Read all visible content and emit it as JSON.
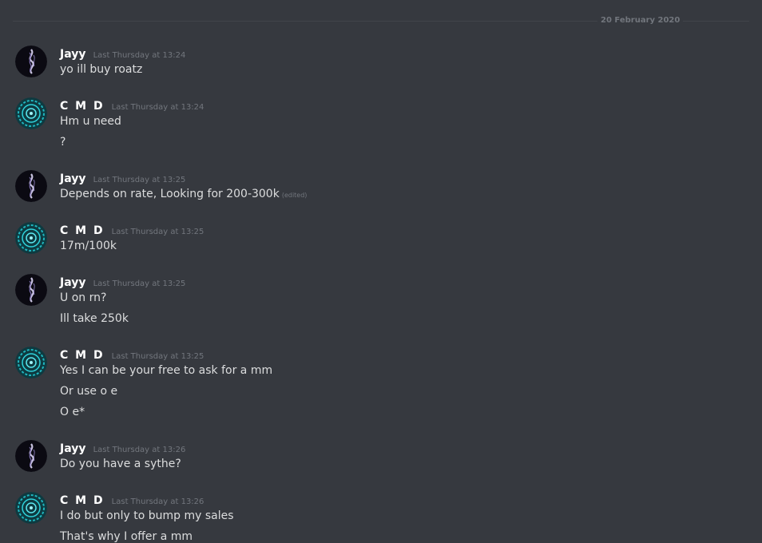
{
  "date_divider": "20 February 2020",
  "colors": {
    "background": "#36393f",
    "username": "#ffffff",
    "message_text": "#dcddde",
    "muted": "#72767d"
  },
  "messages": [
    {
      "author": "Jayy",
      "avatar_icon": "smoke-avatar-icon",
      "timestamp": "Last Thursday at 13:24",
      "lines": [
        "yo ill buy roatz"
      ]
    },
    {
      "author": "C M D",
      "avatar_icon": "cyan-portal-avatar-icon",
      "timestamp": "Last Thursday at 13:24",
      "lines": [
        "Hm u need",
        "?"
      ]
    },
    {
      "author": "Jayy",
      "avatar_icon": "smoke-avatar-icon",
      "timestamp": "Last Thursday at 13:25",
      "lines": [
        "Depends on rate, Looking for 200-300k"
      ],
      "edited_label": "(edited)"
    },
    {
      "author": "C M D",
      "avatar_icon": "cyan-portal-avatar-icon",
      "timestamp": "Last Thursday at 13:25",
      "lines": [
        "17m/100k"
      ]
    },
    {
      "author": "Jayy",
      "avatar_icon": "smoke-avatar-icon",
      "timestamp": "Last Thursday at 13:25",
      "lines": [
        "U on rn?",
        "Ill take 250k"
      ]
    },
    {
      "author": "C M D",
      "avatar_icon": "cyan-portal-avatar-icon",
      "timestamp": "Last Thursday at 13:25",
      "lines": [
        "Yes  I can be your free to ask for a mm",
        "Or use o e",
        "O e*"
      ]
    },
    {
      "author": "Jayy",
      "avatar_icon": "smoke-avatar-icon",
      "timestamp": "Last Thursday at 13:26",
      "lines": [
        "Do you have a sythe?"
      ]
    },
    {
      "author": "C M D",
      "avatar_icon": "cyan-portal-avatar-icon",
      "timestamp": "Last Thursday at 13:26",
      "lines": [
        "I do but only to bump my sales",
        "That's why I offer a mm"
      ]
    }
  ]
}
